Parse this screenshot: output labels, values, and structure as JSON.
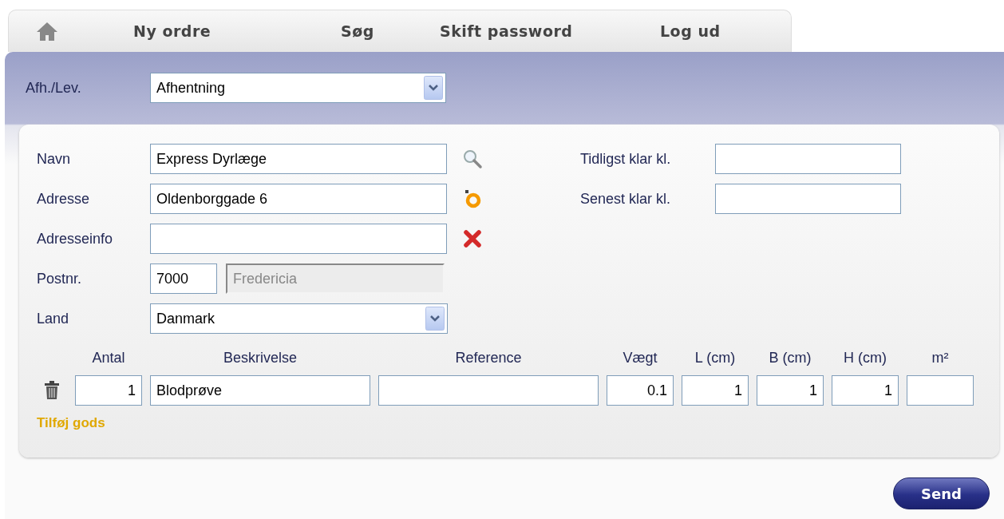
{
  "nav": {
    "items": [
      {
        "label": "Ny ordre"
      },
      {
        "label": "Søg"
      },
      {
        "label": "Skift password"
      },
      {
        "label": "Log ud"
      }
    ]
  },
  "header": {
    "label": "Afh./Lev.",
    "value": "Afhentning"
  },
  "form": {
    "left": [
      {
        "kind": "text",
        "label": "Navn",
        "value": "Express Dyrlæge"
      },
      {
        "kind": "text",
        "label": "Adresse",
        "value": "Oldenborggade 6"
      },
      {
        "kind": "text",
        "label": "Adresseinfo"
      },
      {
        "kind": "postcode",
        "label": "Postnr.",
        "value": "7000",
        "city": {
          "value": "Fredericia",
          "disabled": true
        }
      },
      {
        "kind": "select",
        "label": "Land",
        "value": "Danmark"
      }
    ],
    "right": [
      {
        "label": "Tidligst klar kl."
      },
      {
        "label": "Senest klar kl."
      }
    ]
  },
  "goods": {
    "columns": [
      "Antal",
      "Beskrivelse",
      "Reference",
      "Vægt",
      "L (cm)",
      "B (cm)",
      "H (cm)",
      "m²"
    ],
    "rows": [
      {
        "cells": [
          {
            "value": "1"
          },
          {
            "value": "Blodprøve"
          },
          {},
          {
            "value": "0.1"
          },
          {
            "value": "1"
          },
          {
            "value": "1"
          },
          {
            "value": "1"
          },
          {}
        ]
      }
    ],
    "add_link": "Tilføj gods"
  },
  "send_button": "Send"
}
